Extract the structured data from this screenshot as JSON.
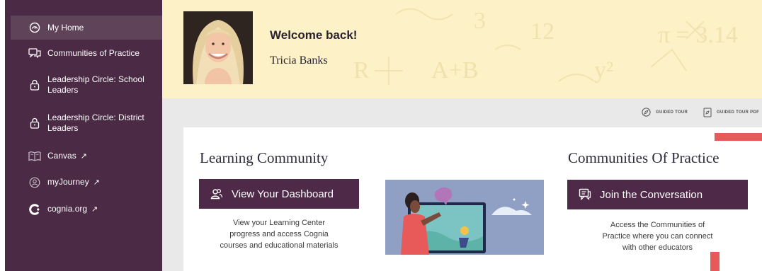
{
  "sidebar": {
    "items": [
      {
        "label": "My Home",
        "icon": "gauge-icon",
        "active": true
      },
      {
        "label": "Communities of Practice",
        "icon": "chat-icon"
      },
      {
        "label": "Leadership Circle: School Leaders",
        "line1": "Leadership Circle: School",
        "line2": "Leaders",
        "icon": "lock-icon"
      },
      {
        "label": "Leadership Circle: District Leaders",
        "line1": "Leadership Circle: District",
        "line2": "Leaders",
        "icon": "lock-icon"
      },
      {
        "label": "Canvas",
        "icon": "book-icon",
        "external": "↗"
      },
      {
        "label": "myJourney",
        "icon": "person-circle-icon",
        "external": "↗"
      },
      {
        "label": "cognia.org",
        "icon": "cognia-logo-icon",
        "external": "↗"
      }
    ]
  },
  "header": {
    "welcome": "Welcome back!",
    "user_name": "Tricia Banks"
  },
  "toolbar": {
    "guided_tour": "GUIDED TOUR",
    "guided_tour_pdf": "GUIDED TOUR PDF"
  },
  "learning": {
    "title": "Learning Community",
    "button": "View Your Dashboard",
    "desc_lines": [
      "View your Learning Center",
      "progress and access Cognia",
      "courses and educational materials"
    ]
  },
  "communities": {
    "title": "Communities Of Practice",
    "button": "Join the Conversation",
    "desc_lines": [
      "Access the Communities of",
      "Practice where you can connect",
      "with other educators"
    ]
  },
  "colors": {
    "sidebar_bg": "#4a2a44",
    "sidebar_active": "#5f4359",
    "header_bg": "#fdf2c7",
    "button_bg": "#4f2948",
    "accent_red": "#e85a5a"
  }
}
